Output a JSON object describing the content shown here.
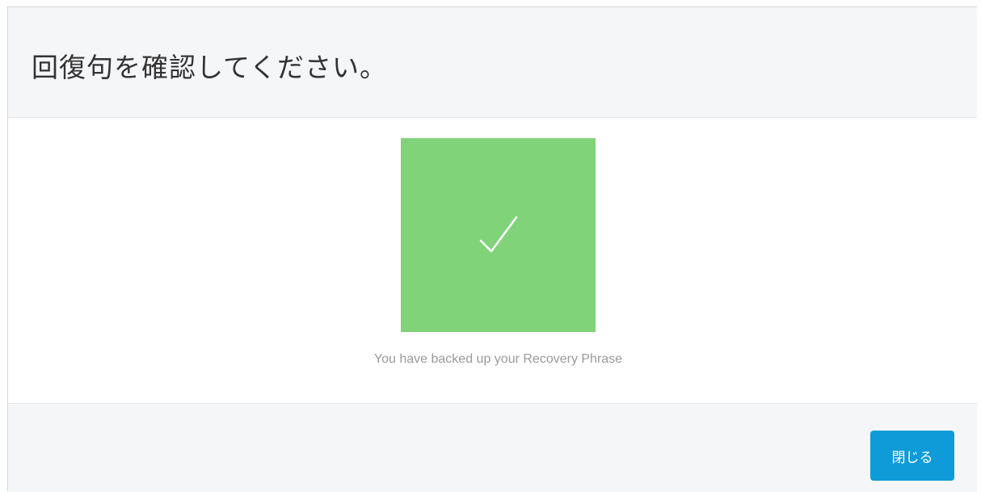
{
  "modal": {
    "title": "回復句を確認してください。",
    "success_message": "You have backed up your Recovery Phrase",
    "close_label": "閉じる",
    "icon": "checkmark-icon"
  },
  "colors": {
    "success_box": "#81d37a",
    "close_button": "#0e9bd8",
    "header_bg": "#f5f6f8",
    "message_text": "#9a9a9a"
  }
}
